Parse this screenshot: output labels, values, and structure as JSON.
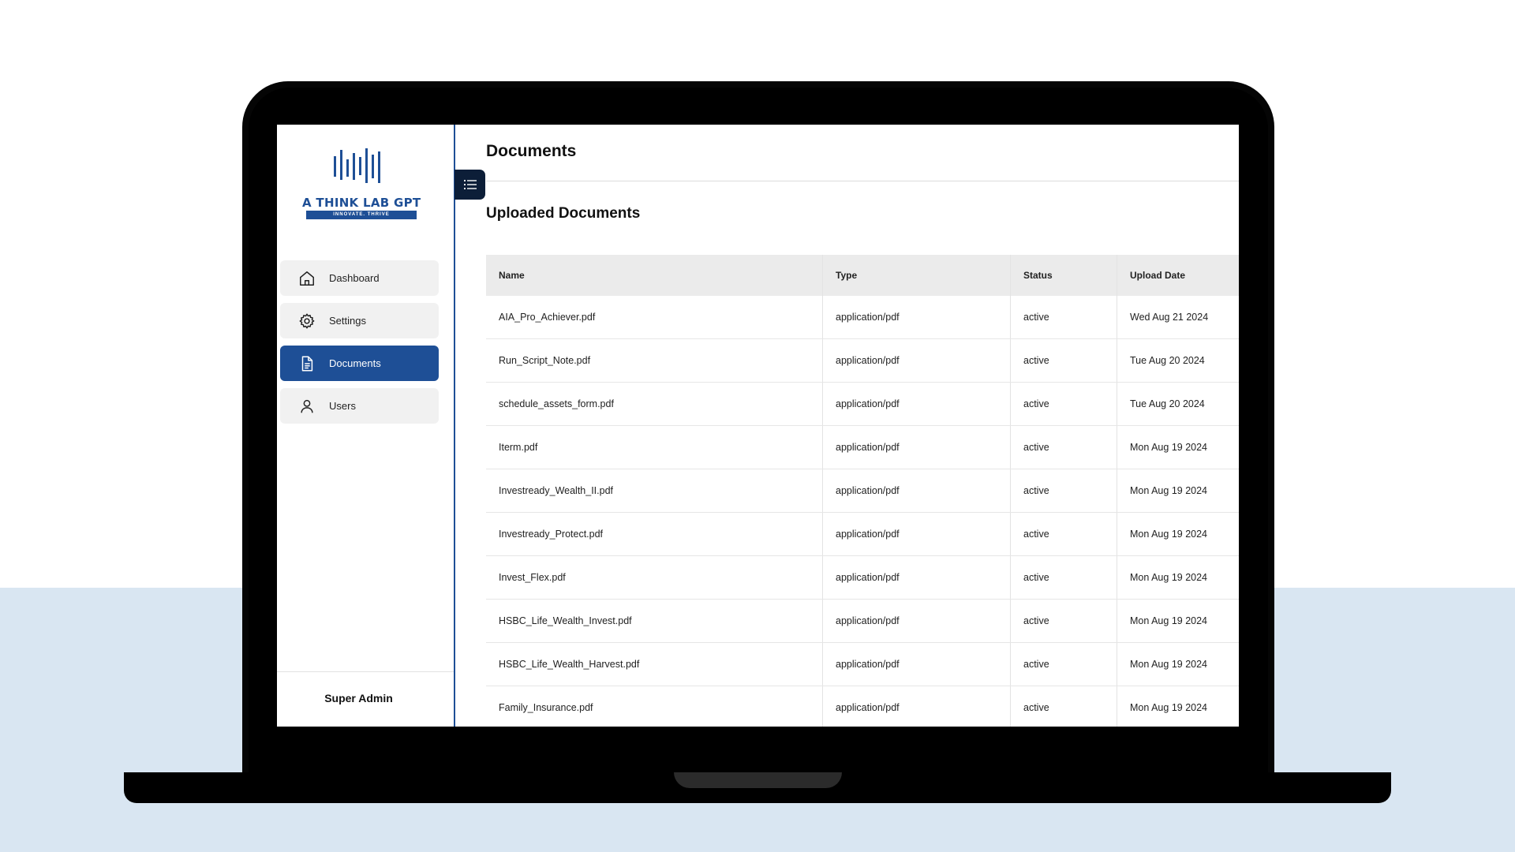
{
  "brand": {
    "name": "A THINK LAB GPT",
    "tagline": "INNOVATE. THRIVE",
    "color": "#1e4f96"
  },
  "sidebar": {
    "items": [
      {
        "label": "Dashboard",
        "icon": "home-icon",
        "active": false
      },
      {
        "label": "Settings",
        "icon": "gear-icon",
        "active": false
      },
      {
        "label": "Documents",
        "icon": "document-icon",
        "active": true
      },
      {
        "label": "Users",
        "icon": "user-icon",
        "active": false
      }
    ],
    "footer_role": "Super Admin"
  },
  "toggle": {
    "icon": "list-icon"
  },
  "main": {
    "title": "Documents",
    "section_title": "Uploaded Documents",
    "table": {
      "columns": [
        "Name",
        "Type",
        "Status",
        "Upload Date"
      ],
      "rows": [
        [
          "AIA_Pro_Achiever.pdf",
          "application/pdf",
          "active",
          "Wed Aug 21 2024"
        ],
        [
          "Run_Script_Note.pdf",
          "application/pdf",
          "active",
          "Tue Aug 20 2024"
        ],
        [
          "schedule_assets_form.pdf",
          "application/pdf",
          "active",
          "Tue Aug 20 2024"
        ],
        [
          "Iterm.pdf",
          "application/pdf",
          "active",
          "Mon Aug 19 2024"
        ],
        [
          "Investready_Wealth_II.pdf",
          "application/pdf",
          "active",
          "Mon Aug 19 2024"
        ],
        [
          "Investready_Protect.pdf",
          "application/pdf",
          "active",
          "Mon Aug 19 2024"
        ],
        [
          "Invest_Flex.pdf",
          "application/pdf",
          "active",
          "Mon Aug 19 2024"
        ],
        [
          "HSBC_Life_Wealth_Invest.pdf",
          "application/pdf",
          "active",
          "Mon Aug 19 2024"
        ],
        [
          "HSBC_Life_Wealth_Harvest.pdf",
          "application/pdf",
          "active",
          "Mon Aug 19 2024"
        ],
        [
          "Family_Insurance.pdf",
          "application/pdf",
          "active",
          "Mon Aug 19 2024"
        ]
      ]
    }
  },
  "colors": {
    "accent": "#1e4f96",
    "toggle_bg": "#0c1e38",
    "backdrop": "#d9e6f2"
  }
}
